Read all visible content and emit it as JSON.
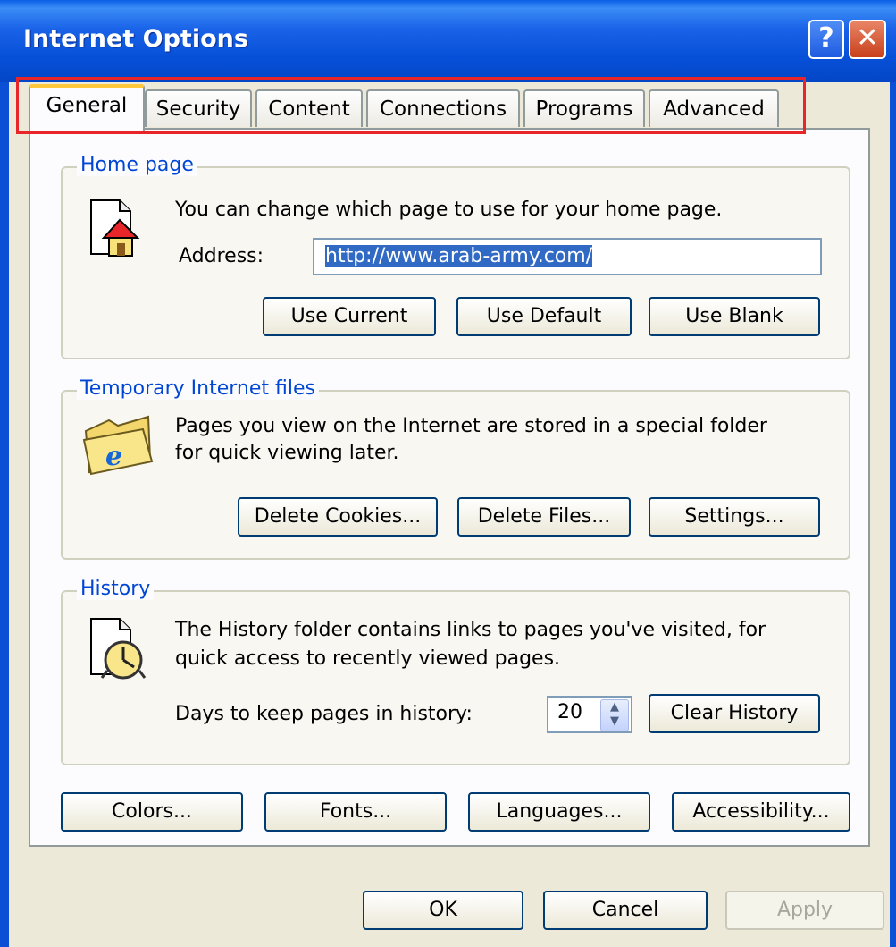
{
  "window": {
    "title": "Internet Options",
    "help_glyph": "?",
    "close_glyph": "✕"
  },
  "tabs": [
    {
      "label": "General",
      "active": true
    },
    {
      "label": "Security"
    },
    {
      "label": "Content"
    },
    {
      "label": "Connections"
    },
    {
      "label": "Programs"
    },
    {
      "label": "Advanced"
    }
  ],
  "home_page": {
    "group_label": "Home page",
    "description": "You can change which page to use for your home page.",
    "address_label": "Address:",
    "address_value": "http://www.arab-army.com/",
    "use_current": "Use Current",
    "use_default": "Use Default",
    "use_blank": "Use Blank",
    "icon": "home-page-icon"
  },
  "temp_files": {
    "group_label": "Temporary Internet files",
    "description_line1": "Pages you view on the Internet are stored in a special folder",
    "description_line2": "for quick viewing later.",
    "delete_cookies": "Delete Cookies...",
    "delete_files": "Delete Files...",
    "settings": "Settings...",
    "icon": "ie-folder-icon"
  },
  "history": {
    "group_label": "History",
    "description_line1": "The History folder contains links to pages you've visited, for",
    "description_line2": "quick access to recently viewed pages.",
    "days_label": "Days to keep pages in history:",
    "days_value": "20",
    "clear_history": "Clear History",
    "icon": "history-clock-icon"
  },
  "bottom_buttons": {
    "colors": "Colors...",
    "fonts": "Fonts...",
    "languages": "Languages...",
    "accessibility": "Accessibility..."
  },
  "dialog_buttons": {
    "ok": "OK",
    "cancel": "Cancel",
    "apply": "Apply"
  },
  "colors": {
    "titlebar": "#0650d8",
    "highlight_box": "#e8262a",
    "group_label": "#0046d5"
  }
}
